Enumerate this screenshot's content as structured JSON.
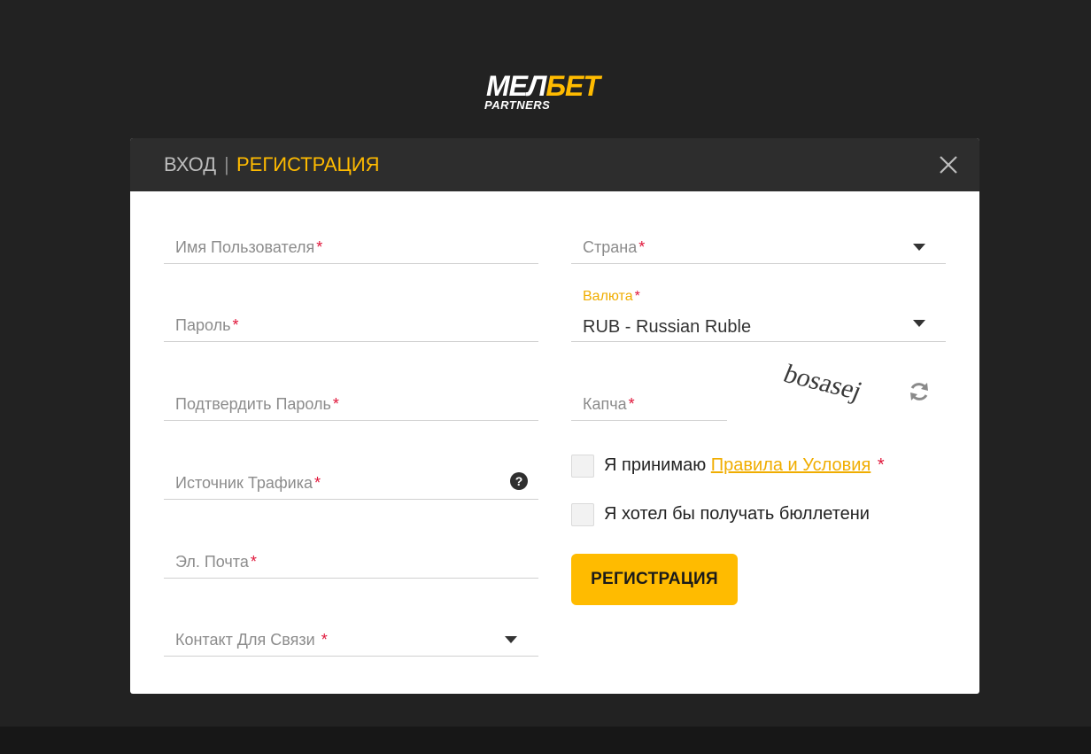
{
  "logo": {
    "main_white": "МЕЛ",
    "main_accent": "БЕТ",
    "sub": "PARTNERS"
  },
  "header": {
    "tab_login": "ВХОД",
    "separator": "|",
    "tab_register": "РЕГИСТРАЦИЯ"
  },
  "form": {
    "left": {
      "username": {
        "label": "Имя Пользователя",
        "req": "*"
      },
      "password": {
        "label": "Пароль",
        "req": "*"
      },
      "confirm_password": {
        "label": "Подтвердить Пароль",
        "req": "*"
      },
      "traffic_source": {
        "label": "Источник Трафика",
        "req": "*",
        "help": "?"
      },
      "email": {
        "label": "Эл. Почта",
        "req": "*"
      },
      "contact": {
        "label": "Контакт Для Связи",
        "req": "*"
      }
    },
    "right": {
      "country": {
        "label": "Страна",
        "req": "*"
      },
      "currency": {
        "label": "Валюта",
        "req": "*",
        "value": "RUB - Russian Ruble"
      },
      "captcha": {
        "label": "Капча",
        "req": "*",
        "image_text": "bosasej"
      },
      "terms": {
        "prefix": "Я принимаю ",
        "link": "Правила и Условия",
        "req": "*"
      },
      "newsletter": {
        "label": "Я хотел бы получать бюллетени"
      },
      "submit": "РЕГИСТРАЦИЯ"
    }
  },
  "icons": {
    "close": "close-icon",
    "refresh": "refresh-icon",
    "help": "question-icon",
    "dropdown": "caret-down-icon"
  },
  "colors": {
    "accent": "#ffbb00",
    "required": "#e0163a",
    "background": "#222222",
    "header": "#2d2d2d"
  }
}
